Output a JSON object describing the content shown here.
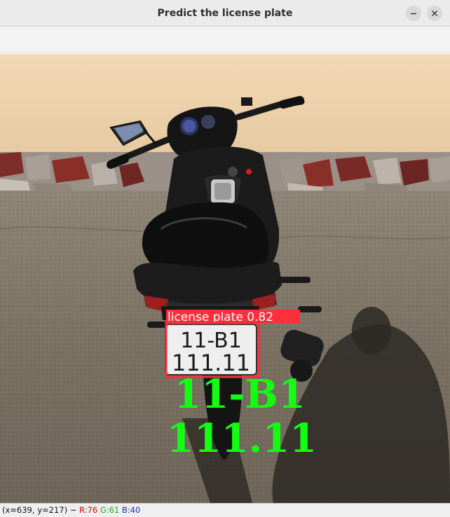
{
  "window": {
    "title": "Predict the license plate",
    "minimize_icon": "minimize-icon",
    "close_icon": "close-icon"
  },
  "image": {
    "detection": {
      "label": "license plate 0.82",
      "box_color": "#ff2e3b"
    },
    "plate": {
      "line1": "11-B1",
      "line2": "111.11"
    },
    "ocr_result": {
      "line1": "11-B1",
      "line2": "111.11",
      "color": "#12ff12"
    }
  },
  "status": {
    "coords": "(x=639, y=217) ~ ",
    "r": "R:76",
    "g": "G:61",
    "b": "B:40"
  }
}
